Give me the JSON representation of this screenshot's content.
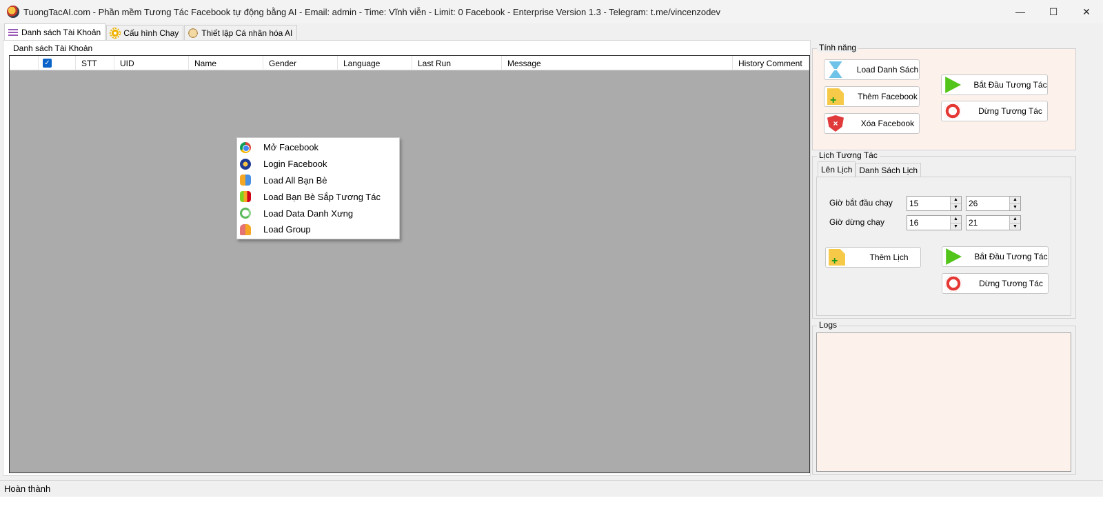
{
  "window": {
    "title": "TuongTacAI.com - Phần mềm Tương Tác Facebook tự động bằng AI - Email: admin - Time: Vĩnh viễn - Limit: 0 Facebook - Enterprise Version 1.3 - Telegram: t.me/vincenzodev",
    "minimize": "—",
    "maximize": "☐",
    "close": "✕"
  },
  "tabs": [
    {
      "label": "Danh sách Tài Khoản",
      "icon": "menu-icon"
    },
    {
      "label": "Cấu hình Chạy",
      "icon": "gear-icon"
    },
    {
      "label": "Thiết lập Cá nhân hóa AI",
      "icon": "brain-icon"
    }
  ],
  "accounts": {
    "group_title": "Danh sách Tài Khoản",
    "columns": [
      "",
      "",
      "STT",
      "UID",
      "Name",
      "Gender",
      "Language",
      "Last Run",
      "Message",
      "History Comment"
    ],
    "select_all_checked": "✓"
  },
  "context_menu": [
    {
      "label": "Mở Facebook",
      "icon": "chrome-icon"
    },
    {
      "label": "Login Facebook",
      "icon": "login-icon"
    },
    {
      "label": "Load All Bạn Bè",
      "icon": "friends-icon"
    },
    {
      "label": "Load Bạn Bè Sắp Tương Tác",
      "icon": "friends-interact-icon"
    },
    {
      "label": "Load Data Danh Xưng",
      "icon": "recycle-icon"
    },
    {
      "label": "Load Group",
      "icon": "group-icon"
    }
  ],
  "features": {
    "title": "Tính năng",
    "load_list": "Load Danh Sách",
    "add_facebook": "Thêm Facebook",
    "delete_facebook": "Xóa Facebook",
    "start": "Bắt Đầu Tương Tác",
    "stop": "Dừng Tương Tác"
  },
  "schedule": {
    "title": "Lịch Tương Tác",
    "tabs": [
      "Lên Lịch",
      "Danh Sách Lịch"
    ],
    "start_label": "Giờ bắt đầu chạy",
    "stop_label": "Giờ dừng chạy",
    "start_hour": "15",
    "start_minute": "26",
    "stop_hour": "16",
    "stop_minute": "21",
    "add": "Thêm Lịch",
    "start": "Bắt Đầu Tương Tác",
    "stop": "Dừng Tương Tác"
  },
  "logs": {
    "title": "Logs"
  },
  "status": {
    "text": "Hoàn thành"
  }
}
